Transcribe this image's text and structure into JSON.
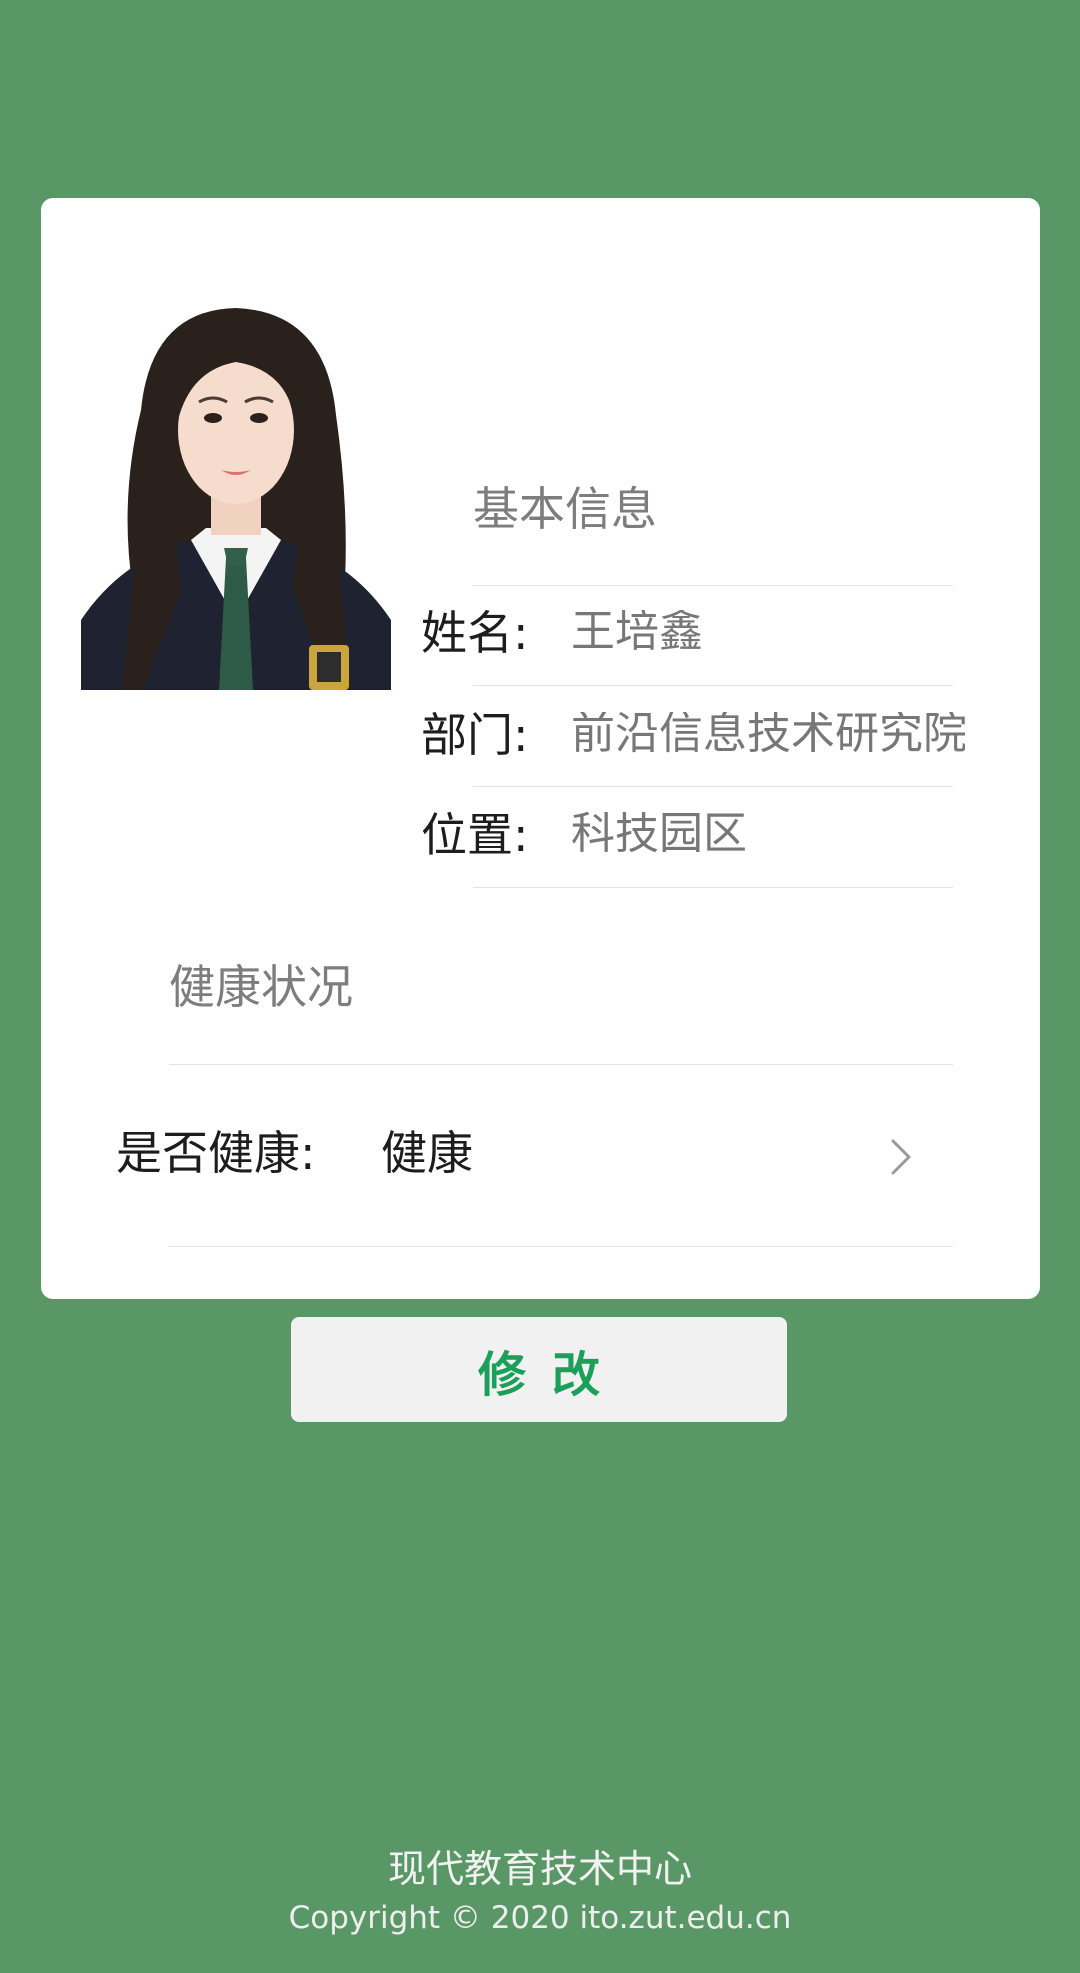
{
  "basic_info": {
    "section_title": "基本信息",
    "name_label": "姓名:",
    "name_value": "王培鑫",
    "dept_label": "部门:",
    "dept_value": "前沿信息技术研究院",
    "location_label": "位置:",
    "location_value": "科技园区"
  },
  "health": {
    "section_title": "健康状况",
    "is_healthy_label": "是否健康:",
    "is_healthy_value": "健康",
    "chevron_icon": "chevron-right-icon"
  },
  "actions": {
    "modify_label": "修改"
  },
  "footer": {
    "org": "现代教育技术中心",
    "copyright": "Copyright © 2020 ito.zut.edu.cn"
  },
  "colors": {
    "background": "#5a9766",
    "card": "#ffffff",
    "accent_green": "#1aa05a",
    "button_bg": "#f1f1f1"
  }
}
